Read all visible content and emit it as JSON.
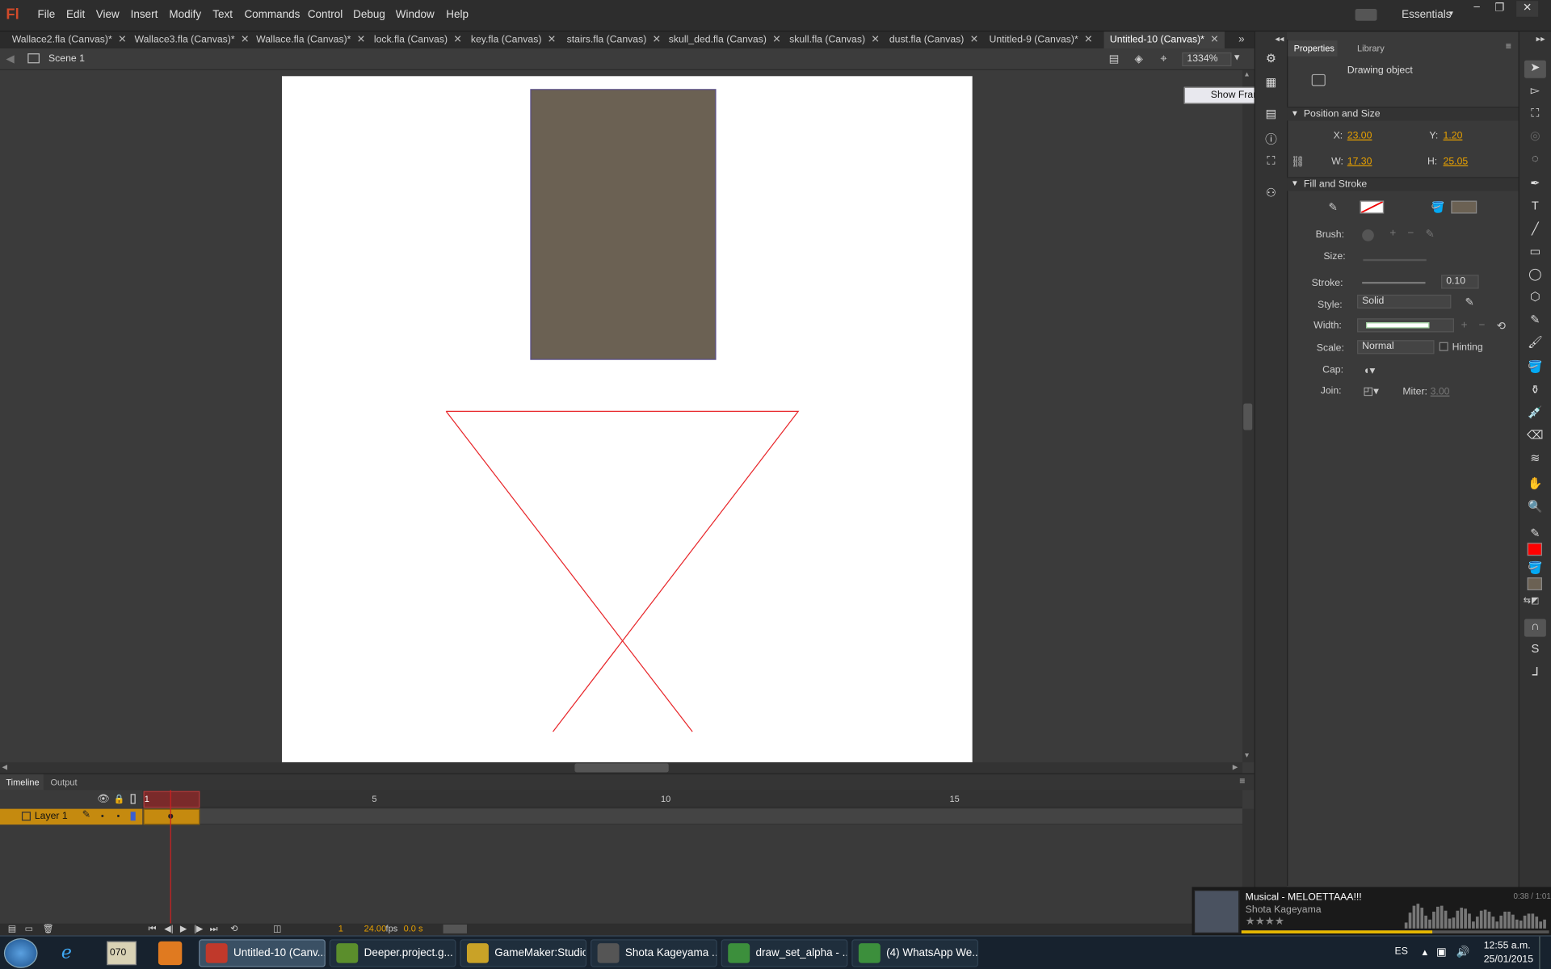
{
  "app": {
    "logo": "Fl",
    "workspace": "Essentials"
  },
  "menu": [
    "File",
    "Edit",
    "View",
    "Insert",
    "Modify",
    "Text",
    "Commands",
    "Control",
    "Debug",
    "Window",
    "Help"
  ],
  "window_controls": [
    "–",
    "❐",
    "✕"
  ],
  "tabs": [
    {
      "label": "Wallace2.fla (Canvas)*",
      "active": false
    },
    {
      "label": "Wallace3.fla (Canvas)*",
      "active": false
    },
    {
      "label": "Wallace.fla (Canvas)*",
      "active": false
    },
    {
      "label": "lock.fla (Canvas)",
      "active": false
    },
    {
      "label": "key.fla (Canvas)",
      "active": false
    },
    {
      "label": "stairs.fla (Canvas)",
      "active": false
    },
    {
      "label": "skull_ded.fla (Canvas)",
      "active": false
    },
    {
      "label": "skull.fla (Canvas)",
      "active": false
    },
    {
      "label": "dust.fla (Canvas)",
      "active": false
    },
    {
      "label": "Untitled-9 (Canvas)*",
      "active": false
    },
    {
      "label": "Untitled-10 (Canvas)*",
      "active": true
    }
  ],
  "editbar": {
    "scene": "Scene 1",
    "zoom": "1334%"
  },
  "stage": {
    "background": "#ffffff",
    "rect_fill": "#6b6153",
    "rect_stroke": "#5a4f8a",
    "x_stroke": "#e8262a"
  },
  "tooltip": "Show Frame",
  "timeline": {
    "tabs": [
      "Timeline",
      "Output"
    ],
    "layer": "Layer 1",
    "frame_numbers": [
      "1",
      "5",
      "10",
      "15"
    ],
    "current_frame": "1",
    "fps": "24.00",
    "fps_unit": "fps",
    "time": "0.0 s"
  },
  "properties": {
    "tabs": [
      "Properties",
      "Library"
    ],
    "object_type": "Drawing object",
    "position_section": "Position and Size",
    "x_label": "X:",
    "x": "23.00",
    "y_label": "Y:",
    "y": "1.20",
    "w_label": "W:",
    "w": "17.30",
    "h_label": "H:",
    "h": "25.05",
    "fill_section": "Fill and Stroke",
    "stroke_color": "#ff0000",
    "fill_color": "#6b6153",
    "brush_label": "Brush:",
    "size_label": "Size:",
    "stroke_label": "Stroke:",
    "stroke_value": "0.10",
    "style_label": "Style:",
    "style_value": "Solid",
    "width_label": "Width:",
    "scale_label": "Scale:",
    "scale_value": "Normal",
    "hinting_label": "Hinting",
    "cap_label": "Cap:",
    "join_label": "Join:",
    "miter_label": "Miter:",
    "miter_value": "3.00"
  },
  "toolbar_colors": {
    "stroke": "#ff0000",
    "fill": "#6b6153"
  },
  "music": {
    "title": "Musical - MELOETTAAA!!!",
    "artist": "Shota Kageyama",
    "time": "0:38 / 1:01",
    "rating": "★★★★",
    "progress": 0.62
  },
  "taskbar": {
    "clock_time": "12:55 a.m.",
    "clock_date": "25/01/2015",
    "lang": "ES",
    "buttons": [
      {
        "label": "Untitled-10 (Canv...",
        "active": true,
        "icon_color": "#c0392b"
      },
      {
        "label": "Deeper.project.g...",
        "active": false,
        "icon_color": "#5b8e2c"
      },
      {
        "label": "GameMaker:Studio",
        "active": false,
        "icon_color": "#c9a227"
      },
      {
        "label": "Shota Kageyama ...",
        "active": false,
        "icon_color": "#555555"
      },
      {
        "label": "draw_set_alpha - ...",
        "active": false,
        "icon_color": "#3c8f3c"
      },
      {
        "label": "(4) WhatsApp We...",
        "active": false,
        "icon_color": "#3c8f3c"
      }
    ],
    "quicklaunch_overlay": "070"
  }
}
